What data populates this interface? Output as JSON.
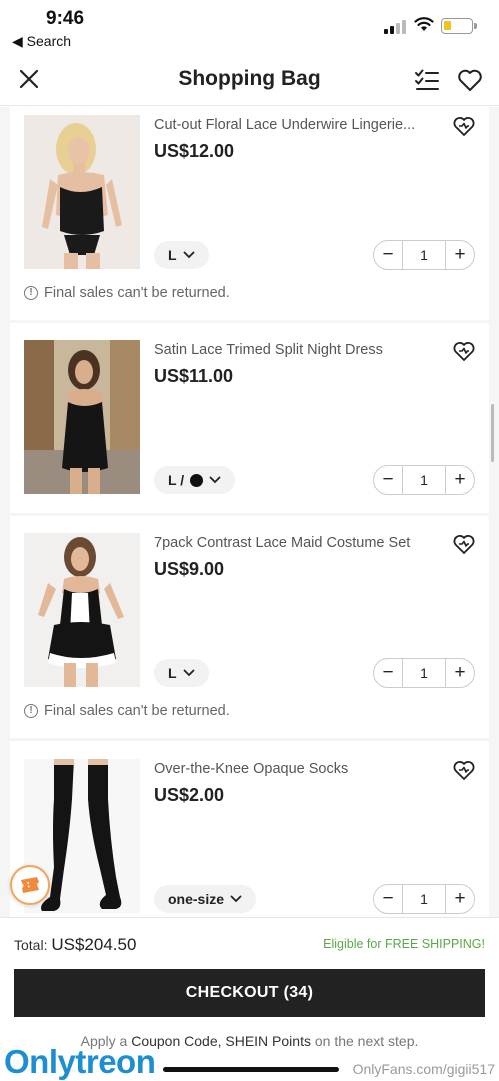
{
  "status": {
    "time": "9:46",
    "back_label": "◀ Search"
  },
  "nav": {
    "title": "Shopping Bag"
  },
  "items": [
    {
      "title": "Cut-out Floral Lace Underwire Lingerie...",
      "price": "US$12.00",
      "size": "L",
      "qty": "1",
      "note": "Final sales can't be returned."
    },
    {
      "title": "Satin Lace Trimed Split Night Dress",
      "price": "US$11.00",
      "size": "L /",
      "qty": "1"
    },
    {
      "title": "7pack Contrast Lace Maid Costume Set",
      "price": "US$9.00",
      "size": "L",
      "qty": "1",
      "note": "Final sales can't be returned."
    },
    {
      "title": "Over-the-Knee Opaque Socks",
      "price": "US$2.00",
      "size": "one-size",
      "qty": "1"
    }
  ],
  "stepper": {
    "minus": "−",
    "plus": "+"
  },
  "footer": {
    "total_label": "Total:",
    "total_value": "US$204.50",
    "shipping": "Eligible for FREE SHIPPING!",
    "checkout": "CHECKOUT (34)",
    "coupon_pre": "Apply a",
    "coupon_link": "Coupon Code, SHEIN Points",
    "coupon_post": "on the next step."
  },
  "watermark": {
    "logo_a": "Only",
    "logo_b": "treon",
    "url": "OnlyFans.com/gigii517"
  },
  "colors": {
    "accent": "#222222",
    "shipping_green": "#5aa845",
    "badge_orange": "#f3a45b"
  }
}
